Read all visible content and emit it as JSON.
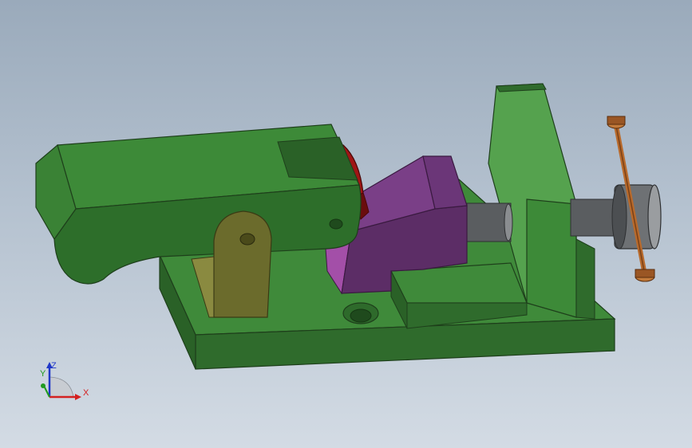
{
  "viewport": {
    "background_top": "#9aaabb",
    "background_bottom": "#d3dbe4"
  },
  "model": {
    "colors": {
      "base_top": "#3f8a3a",
      "base_side": "#2f6b2c",
      "base_edge": "#1e3f1b",
      "upright_face": "#3d8a38",
      "upright_light": "#55a24e",
      "clamp_arm_top": "#3d8a38",
      "clamp_arm_side": "#2d6e2a",
      "jaw_light": "#7a3f87",
      "jaw_dark": "#5c2d66",
      "jaw_pink": "#a34fa8",
      "roller_red": "#a01515",
      "roller_dark": "#6a0d0d",
      "pivot_plate": "#6b6b2c",
      "pivot_plate_light": "#8a8a40",
      "screw_gray": "#5a5d60",
      "screw_light": "#8a8d90",
      "handle_bronze": "#b86a2c",
      "handle_dark": "#7a4016"
    }
  },
  "triad": {
    "x_label": "X",
    "y_label": "Y",
    "z_label": "Z",
    "x_color": "#d42020",
    "y_color": "#1f9a1f",
    "z_color": "#2038c8"
  }
}
